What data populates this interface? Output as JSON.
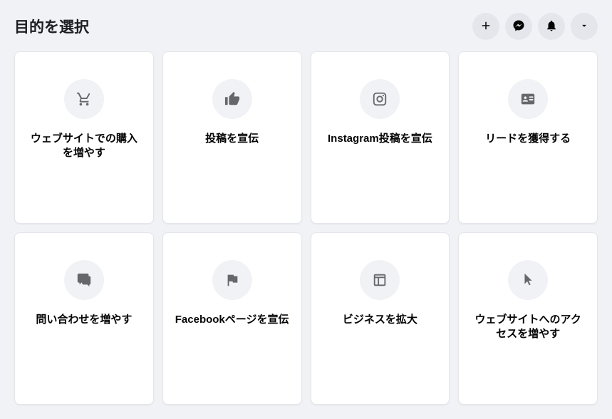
{
  "header": {
    "title": "目的を選択"
  },
  "cards": [
    {
      "label": "ウェブサイトでの購入を増やす"
    },
    {
      "label": "投稿を宣伝"
    },
    {
      "label": "Instagram投稿を宣伝"
    },
    {
      "label": "リードを獲得する"
    },
    {
      "label": "問い合わせを増やす"
    },
    {
      "label": "Facebookページを宣伝"
    },
    {
      "label": "ビジネスを拡大"
    },
    {
      "label": "ウェブサイトへのアクセスを増やす"
    }
  ]
}
